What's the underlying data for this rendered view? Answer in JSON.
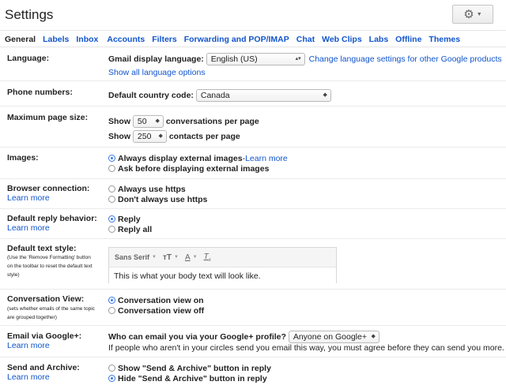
{
  "header": {
    "title": "Settings"
  },
  "tabs": [
    "General",
    "Labels",
    "Inbox",
    "Accounts",
    "Filters",
    "Forwarding and POP/IMAP",
    "Chat",
    "Web Clips",
    "Labs",
    "Offline",
    "Themes"
  ],
  "language": {
    "label": "Language:",
    "display_label": "Gmail display language:",
    "value": "English (US)",
    "change_link": "Change language settings for other Google products",
    "show_all": "Show all language options"
  },
  "phone": {
    "label": "Phone numbers:",
    "country_label": "Default country code:",
    "value": "Canada"
  },
  "page_size": {
    "label": "Maximum page size:",
    "show": "Show",
    "conv_value": "50",
    "conv_suffix": "conversations per page",
    "contacts_value": "250",
    "contacts_suffix": "contacts per page"
  },
  "images": {
    "label": "Images:",
    "opt1": "Always display external images",
    "opt1_sep": " - ",
    "opt1_link": "Learn more",
    "opt2": "Ask before displaying external images"
  },
  "browser": {
    "label": "Browser connection:",
    "learn": "Learn more",
    "opt1": "Always use https",
    "opt2": "Don't always use https"
  },
  "reply": {
    "label": "Default reply behavior:",
    "learn": "Learn more",
    "opt1": "Reply",
    "opt2": "Reply all"
  },
  "text_style": {
    "label": "Default text style:",
    "note1": "(Use the 'Remove Formatting' button",
    "note2": "on the toolbar to reset the default text",
    "note3": "style)",
    "font": "Sans Serif",
    "sample": "This is what your body text will look like."
  },
  "conversation": {
    "label": "Conversation View:",
    "note1": "(sets whether emails of the same topic",
    "note2": "are grouped together)",
    "opt1": "Conversation view on",
    "opt2": "Conversation view off"
  },
  "gplus": {
    "label": "Email via Google+:",
    "learn": "Learn more",
    "question": "Who can email you via your Google+ profile?",
    "value": "Anyone on Google+",
    "note": "If people who aren't in your circles send you email this way, you must agree before they can send you more."
  },
  "send_archive": {
    "label": "Send and Archive:",
    "learn": "Learn more",
    "opt1": "Show \"Send & Archive\" button in reply",
    "opt2": "Hide \"Send & Archive\" button in reply"
  }
}
